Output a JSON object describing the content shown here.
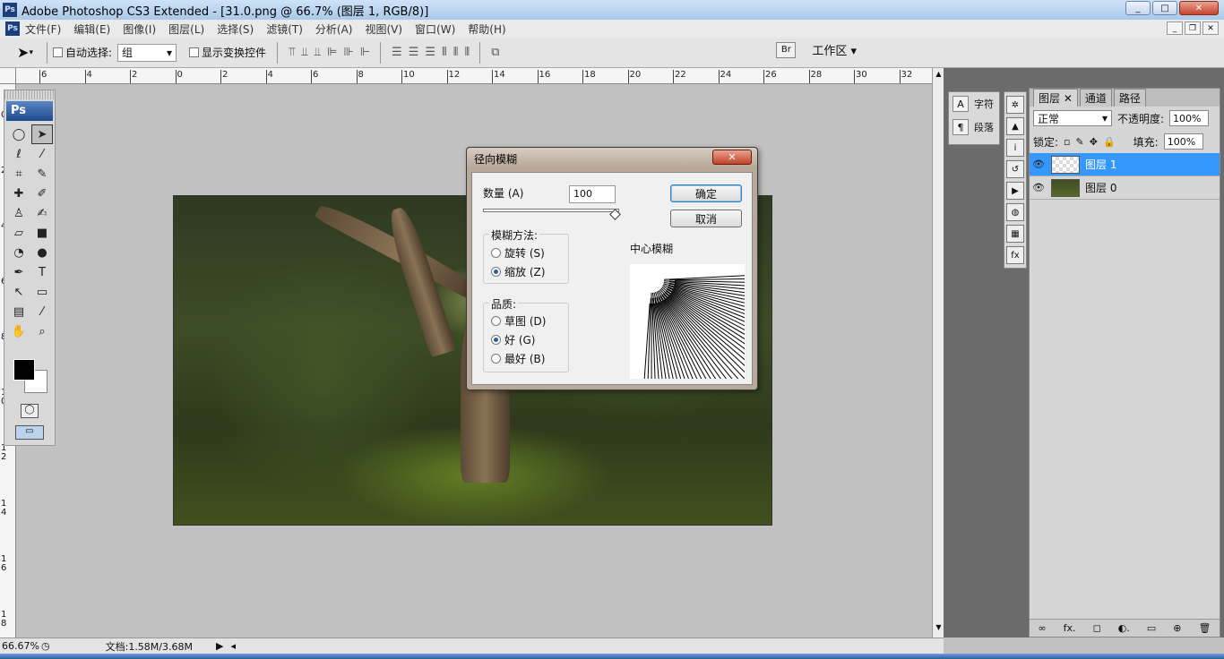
{
  "window": {
    "title": "Adobe Photoshop CS3 Extended - [31.0.png @ 66.7% (图层 1, RGB/8)]",
    "app_badge": "Ps",
    "controls": [
      "_",
      "□",
      "✕"
    ]
  },
  "menu": {
    "items": [
      "文件(F)",
      "编辑(E)",
      "图像(I)",
      "图层(L)",
      "选择(S)",
      "滤镜(T)",
      "分析(A)",
      "视图(V)",
      "窗口(W)",
      "帮助(H)"
    ],
    "mdi_controls": [
      "_",
      "❐",
      "✕"
    ]
  },
  "options_bar": {
    "auto_select_label": "自动选择:",
    "auto_select_value": "组",
    "show_transform_label": "显示变换控件",
    "workspace_label": "工作区 ▾"
  },
  "ruler": {
    "h_ticks": [
      "6",
      "4",
      "2",
      "0",
      "2",
      "4",
      "6",
      "8",
      "10",
      "12",
      "14",
      "16",
      "18",
      "20",
      "22",
      "24",
      "26",
      "28",
      "30",
      "32"
    ],
    "v_ticks": [
      "0",
      "2",
      "4",
      "6",
      "8",
      "1\n0",
      "1\n2",
      "1\n4",
      "1\n6",
      "1\n8"
    ]
  },
  "toolbox": {
    "logo": "Ps"
  },
  "small_panel": {
    "character": "字符",
    "paragraph": "段落"
  },
  "layers_panel": {
    "tabs": [
      "图层",
      "通道",
      "路径"
    ],
    "blend_mode": "正常",
    "opacity_label": "不透明度:",
    "opacity_value": "100%",
    "lock_label": "锁定:",
    "fill_label": "填充:",
    "fill_value": "100%",
    "layers": [
      {
        "name": "图层 1",
        "selected": true
      },
      {
        "name": "图层 0",
        "selected": false
      }
    ],
    "footer_icons": [
      "∞",
      "fx.",
      "◻",
      "◐.",
      "▭",
      "⊕",
      "🗑"
    ]
  },
  "status": {
    "zoom": "66.67%",
    "doc": "文档:1.58M/3.68M"
  },
  "dialog": {
    "title": "径向模糊",
    "amount_label": "数量 (A)",
    "amount_value": "100",
    "amount_fraction": 1.0,
    "ok": "确定",
    "cancel": "取消",
    "method_title": "模糊方法:",
    "method_options": [
      {
        "label": "旋转 (S)",
        "checked": false
      },
      {
        "label": "缩放 (Z)",
        "checked": true
      }
    ],
    "quality_title": "品质:",
    "quality_options": [
      {
        "label": "草图 (D)",
        "checked": false
      },
      {
        "label": "好 (G)",
        "checked": true
      },
      {
        "label": "最好 (B)",
        "checked": false
      }
    ],
    "center_label": "中心模糊"
  },
  "colors": {
    "accent_selected": "#3399ff",
    "canvas_bg": "#c1c1c1",
    "foreground": "#000000",
    "background": "#ffffff"
  }
}
